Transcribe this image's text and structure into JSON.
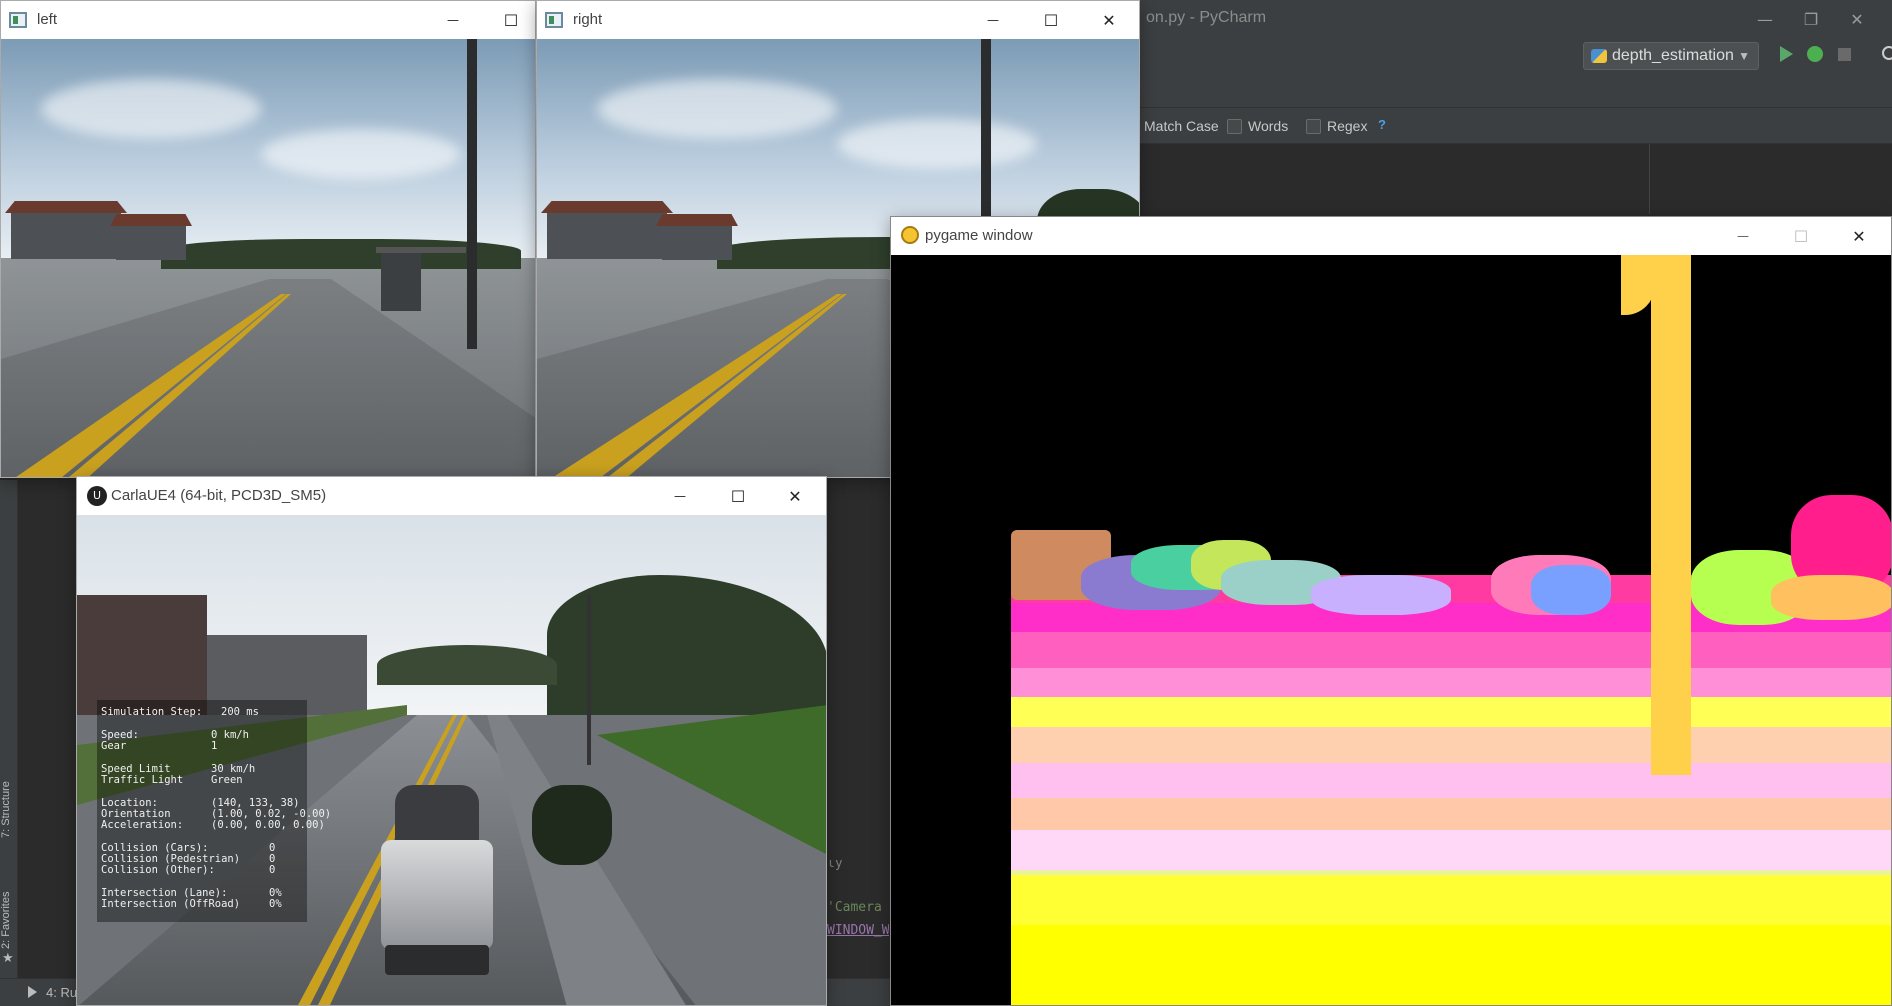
{
  "pycharm": {
    "title_suffix": "on.py - PyCharm",
    "run_config": "depth_estimation",
    "search": {
      "match_case": "Match Case",
      "words": "Words",
      "regex": "Regex",
      "help": "?"
    },
    "left_tabs": [
      "Structure",
      "Favorites"
    ],
    "left_tab_numbers": [
      "7:",
      "2:"
    ],
    "bottom_run_tab": "4: Ru",
    "code_lines": [
      "'Camera",
      "WINDOW_W",
      "ly"
    ]
  },
  "windows": {
    "left": {
      "title": "left"
    },
    "right": {
      "title": "right"
    },
    "pygame": {
      "title": "pygame window"
    },
    "carla": {
      "title": "CarlaUE4 (64-bit, PCD3D_SM5)"
    }
  },
  "controls": {
    "minimize": "—",
    "maximize": "☐",
    "close": "✕"
  },
  "carla_hud": {
    "simulation_step_label": "Simulation Step:",
    "simulation_step_value": "200 ms",
    "speed_label": "Speed:",
    "speed_value": "0 km/h",
    "gear_label": "Gear",
    "gear_value": "1",
    "speed_limit_label": "Speed Limit",
    "speed_limit_value": "30 km/h",
    "traffic_light_label": "Traffic Light",
    "traffic_light_value": "Green",
    "location_label": "Location:",
    "location_value": "(140, 133, 38)",
    "orientation_label": "Orientation",
    "orientation_value": "(1.00, 0.02, -0.00)",
    "acceleration_label": "Acceleration:",
    "acceleration_value": "(0.00, 0.00, 0.00)",
    "collision_cars_label": "Collision (Cars):",
    "collision_cars_value": "0",
    "collision_ped_label": "Collision (Pedestrian)",
    "collision_ped_value": "0",
    "collision_other_label": "Collision (Other):",
    "collision_other_value": "0",
    "intersection_lane_label": "Intersection (Lane):",
    "intersection_lane_value": "0%",
    "intersection_offroad_label": "Intersection (OffRoad)",
    "intersection_offroad_value": "0%"
  },
  "colors": {
    "ide_bg": "#2b2b2b",
    "ide_panel": "#3c3f41",
    "run_green": "#59a869",
    "debug_green": "#4caf50",
    "depth_yellow": "#ffff00",
    "depth_pink": "#ffc0f0",
    "depth_magenta": "#ff2ec8"
  }
}
